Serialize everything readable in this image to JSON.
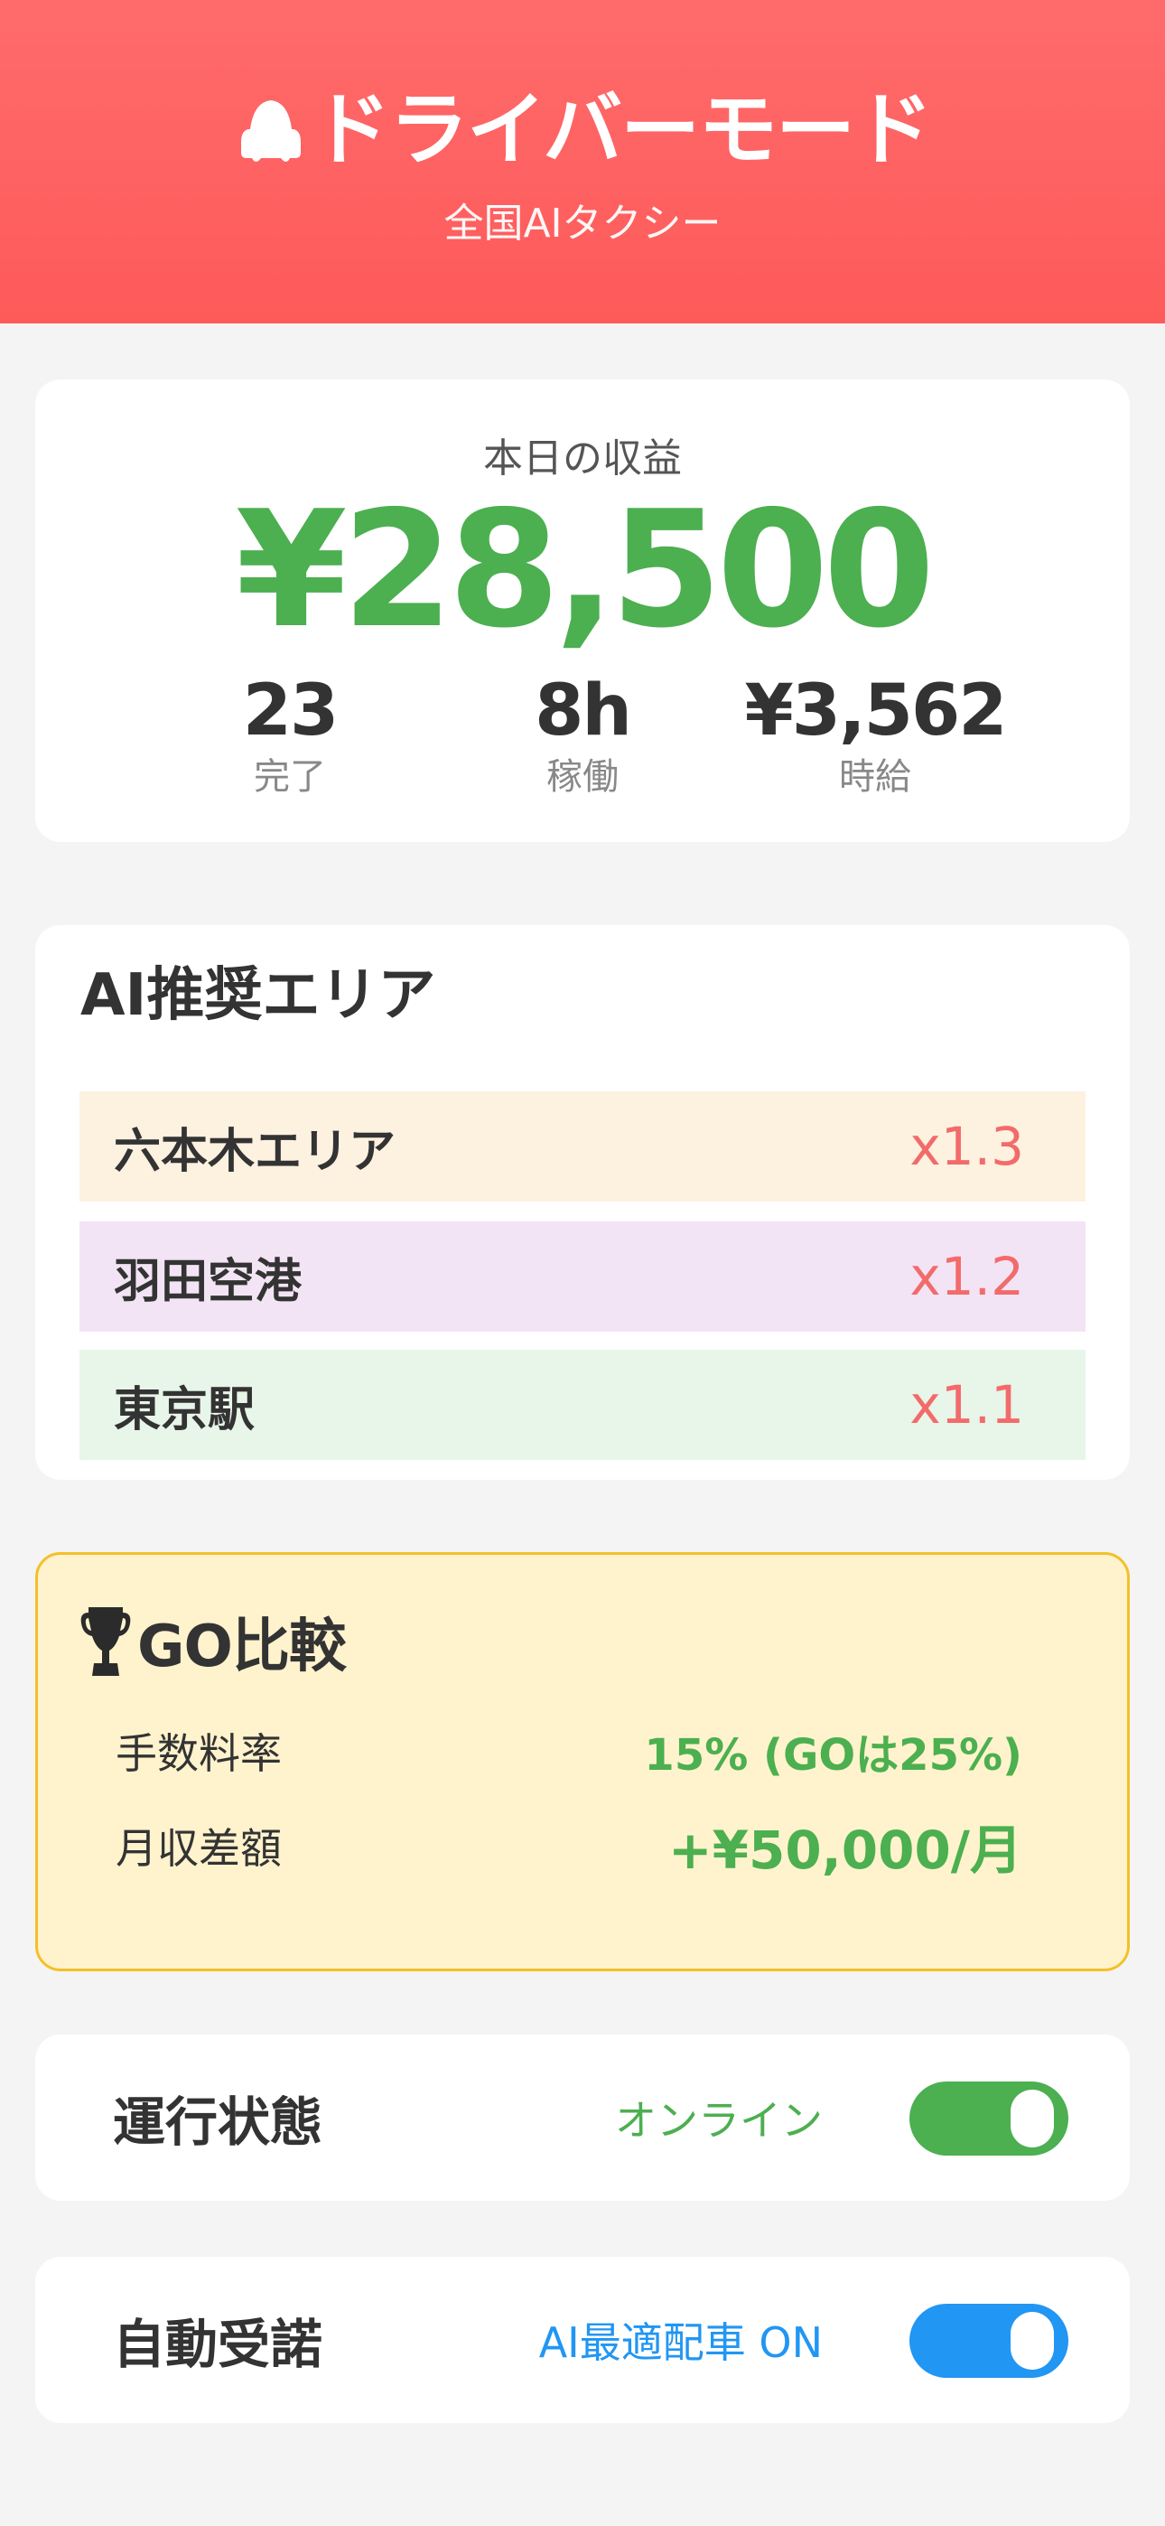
{
  "header": {
    "title": "ドライバーモード",
    "subtitle": "全国AIタクシー",
    "icon": "car-icon"
  },
  "earnings": {
    "label": "本日の収益",
    "amount": "¥28,500",
    "stats": [
      {
        "value": "23",
        "label": "完了"
      },
      {
        "value": "8h",
        "label": "稼働"
      },
      {
        "value": "¥3,562",
        "label": "時給"
      }
    ]
  },
  "recommended_areas": {
    "heading": "AI推奨エリア",
    "items": [
      {
        "name": "六本木エリア",
        "multiplier": "x1.3",
        "bg": "#fdf1e0"
      },
      {
        "name": "羽田空港",
        "multiplier": "x1.2",
        "bg": "#f3e4f5"
      },
      {
        "name": "東京駅",
        "multiplier": "x1.1",
        "bg": "#e8f5e9"
      }
    ]
  },
  "go_comparison": {
    "heading": "GO比較",
    "icon": "trophy-icon",
    "rows": [
      {
        "label": "手数料率",
        "value": "15% (GOは25%)"
      },
      {
        "label": "月収差額",
        "value": "+¥50,000/月"
      }
    ]
  },
  "operation": {
    "label": "運行状態",
    "status": "オンライン",
    "enabled": true,
    "color": "#4caf50"
  },
  "auto_accept": {
    "label": "自動受諾",
    "status": "AI最適配車 ON",
    "enabled": true,
    "color": "#2196f3"
  },
  "colors": {
    "header": "#ff5e5e",
    "earnings_green": "#4caf50",
    "multiplier_red": "#f26b6b",
    "go_bg": "#fff3cd",
    "go_border": "#f4c028"
  }
}
